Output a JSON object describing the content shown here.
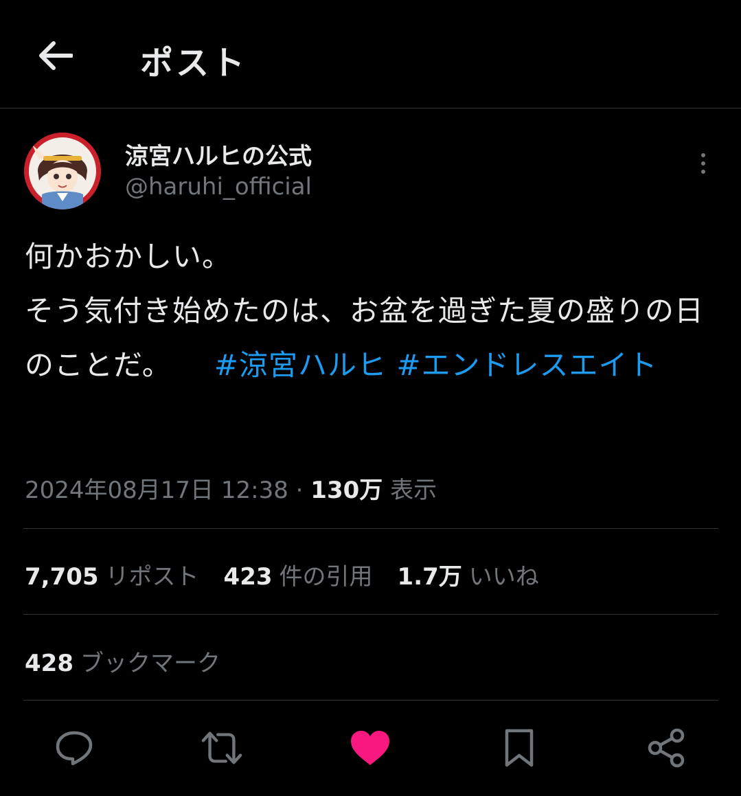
{
  "header": {
    "title": "ポスト",
    "back_icon": "arrow-left-icon"
  },
  "author": {
    "display_name": "涼宮ハルヒの公式",
    "handle": "@haruhi_official"
  },
  "post": {
    "line1": "何かおかしい。",
    "line2_text": "そう気付き始めたのは、お盆を過ぎた夏の盛りの日のことだ。",
    "hashtag1": "#涼宮ハルヒ",
    "hashtag2": "#エンドレスエイト",
    "hashtag_color": "#1d9bf0"
  },
  "meta": {
    "timestamp": "2024年08月17日 12:38",
    "separator": "·",
    "views_count": "130万",
    "views_label": "表示"
  },
  "stats": {
    "reposts_count": "7,705",
    "reposts_label": "リポスト",
    "quotes_count": "423",
    "quotes_label": "件の引用",
    "likes_count": "1.7万",
    "likes_label": "いいね"
  },
  "bookmarks": {
    "count": "428",
    "label": "ブックマーク"
  },
  "actions": [
    {
      "icon": "reply-icon"
    },
    {
      "icon": "repost-icon"
    },
    {
      "icon": "heart-icon",
      "active": true,
      "color": "#f91880"
    },
    {
      "icon": "bookmark-icon"
    },
    {
      "icon": "share-icon"
    }
  ]
}
